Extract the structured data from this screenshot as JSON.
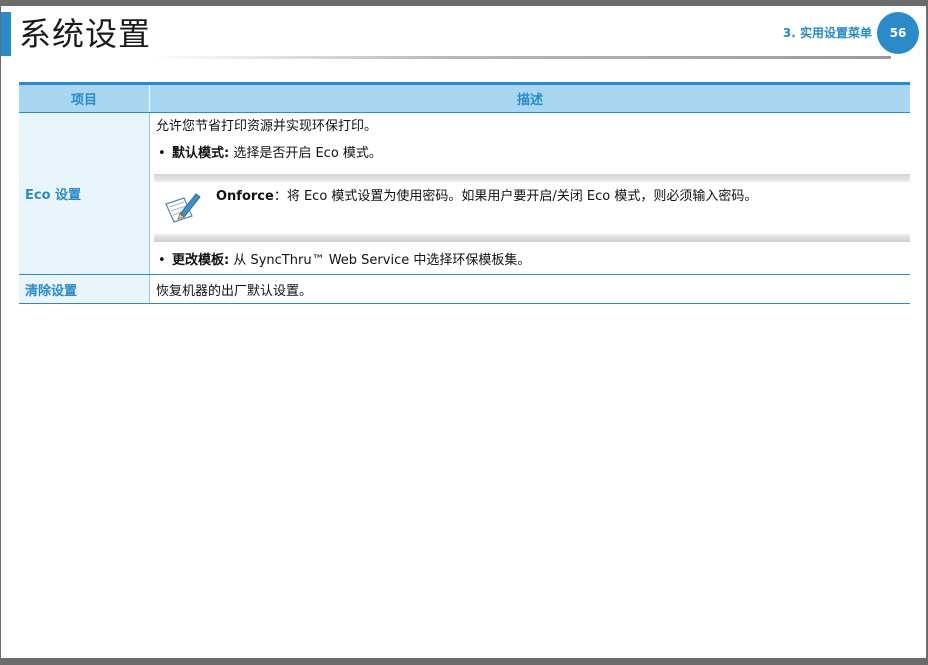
{
  "header": {
    "title": "系统设置",
    "chapter": "3. 实用设置菜单",
    "page_number": "56"
  },
  "table": {
    "columns": [
      "项目",
      "描述"
    ],
    "rows": [
      {
        "item": "Eco 设置",
        "intro": "允许您节省打印资源并实现环保打印。",
        "bullet1_label": "默认模式:",
        "bullet1_text": " 选择是否开启 Eco 模式。",
        "note_label": "Onforce",
        "note_text": "：将 Eco 模式设置为使用密码。如果用户要开启/关闭 Eco 模式，则必须输入密码。",
        "bullet2_label": "更改模板:",
        "bullet2_text": " 从 SyncThru™ Web Service 中选择环保模板集。"
      },
      {
        "item": "清除设置",
        "desc": "恢复机器的出厂默认设置。"
      }
    ]
  },
  "icons": {
    "note": "note-pencil-icon",
    "bullet": "•"
  },
  "colors": {
    "accent": "#2a8bc8",
    "header_fill": "#a9d6f0",
    "item_fill": "#eaf4fb"
  }
}
